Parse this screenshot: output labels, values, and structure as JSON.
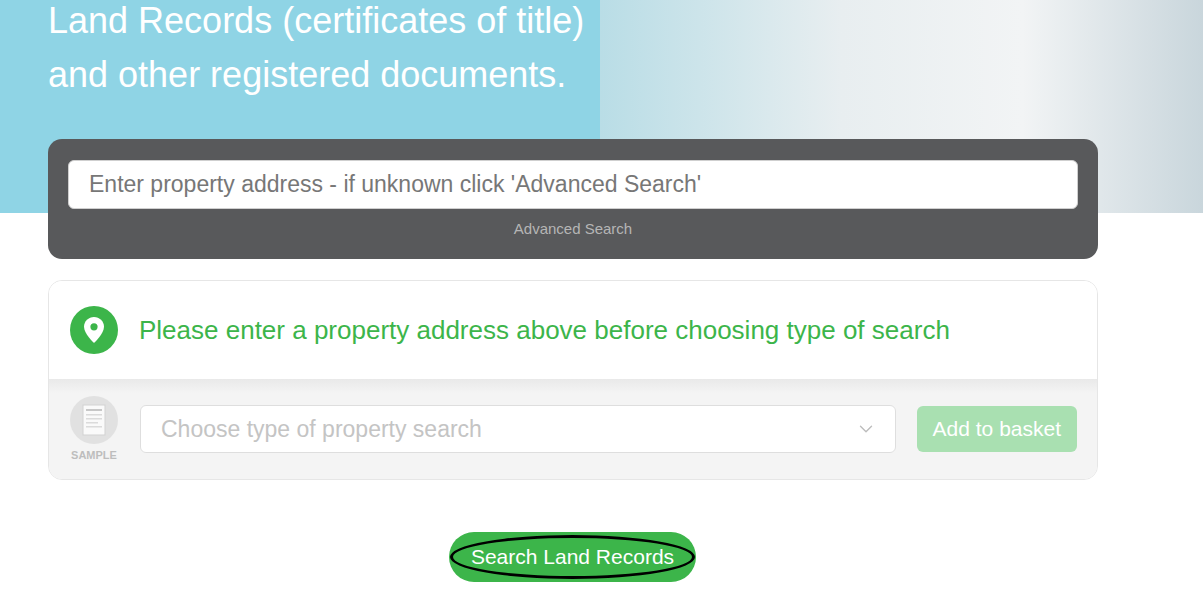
{
  "hero": {
    "title_lines": [
      "Land Records (certificates of title)",
      "and other registered documents."
    ]
  },
  "search": {
    "placeholder": "Enter property address - if unknown click 'Advanced Search'",
    "advanced_link": "Advanced Search"
  },
  "search_card": {
    "notice": "Please enter a property address above before choosing type of search",
    "sample_label": "SAMPLE",
    "sample_disabled": true,
    "select": {
      "placeholder": "Choose type of property search",
      "disabled": true
    },
    "add_button": {
      "label": "Add to basket",
      "disabled": true
    }
  },
  "search_button": {
    "label": "Search Land Records",
    "circled": true
  }
}
